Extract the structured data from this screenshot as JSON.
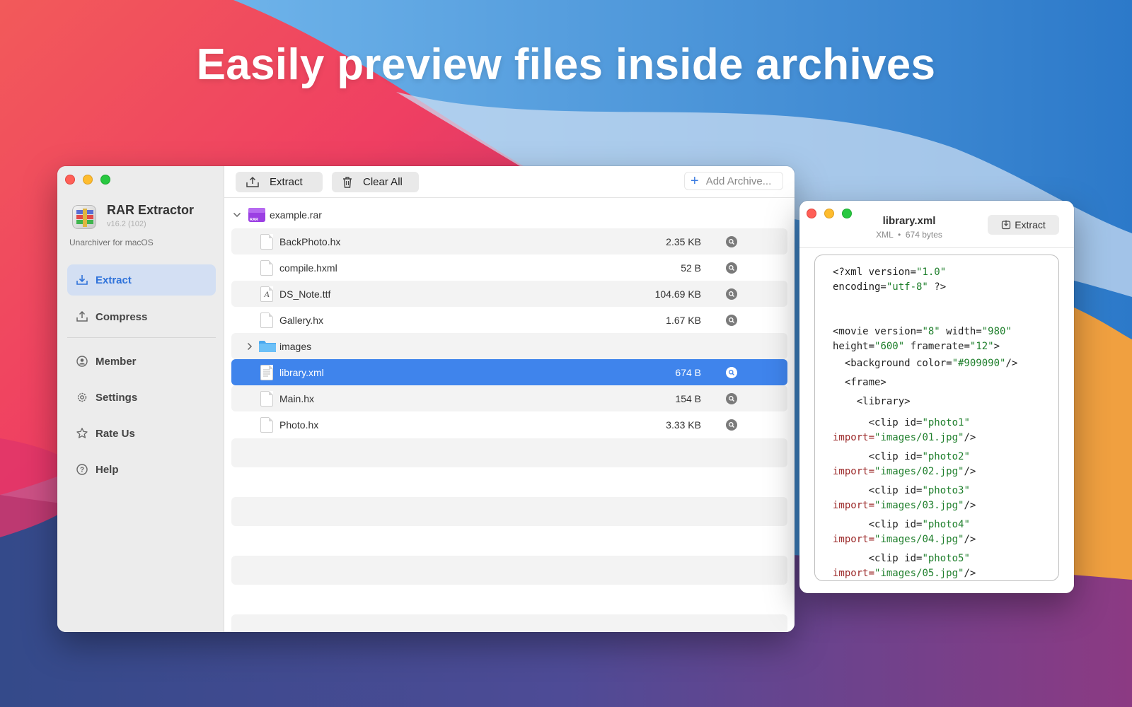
{
  "headline": "Easily preview files inside archives",
  "colors": {
    "accent": "#3f84ec",
    "sidebar_active_bg": "#d3dff3",
    "code_value": "#1f7f2c",
    "code_attr": "#9c2a2a"
  },
  "app": {
    "name": "RAR Extractor",
    "version": "v16.2 (102)",
    "subtitle": "Unarchiver for macOS",
    "nav": [
      {
        "label": "Extract",
        "icon": "extract-icon",
        "active": true
      },
      {
        "label": "Compress",
        "icon": "compress-icon"
      },
      {
        "label": "Member",
        "icon": "person-icon"
      },
      {
        "label": "Settings",
        "icon": "gear-icon"
      },
      {
        "label": "Rate Us",
        "icon": "star-icon"
      },
      {
        "label": "Help",
        "icon": "question-icon"
      }
    ]
  },
  "toolbar": {
    "extract_label": "Extract",
    "clear_label": "Clear All",
    "add_label": "Add Archive..."
  },
  "archive": {
    "name": "example.rar",
    "files": [
      {
        "name": "BackPhoto.hx",
        "size": "2.35 KB"
      },
      {
        "name": "compile.hxml",
        "size": "52 B"
      },
      {
        "name": "DS_Note.ttf",
        "size": "104.69 KB"
      },
      {
        "name": "Gallery.hx",
        "size": "1.67 KB"
      },
      {
        "name": "images",
        "size": ""
      },
      {
        "name": "library.xml",
        "size": "674 B",
        "selected": true
      },
      {
        "name": "Main.hx",
        "size": "154 B"
      },
      {
        "name": "Photo.hx",
        "size": "3.33 KB"
      }
    ]
  },
  "preview": {
    "title": "library.xml",
    "type": "XML",
    "separator": "•",
    "size": "674 bytes",
    "extract_label": "Extract",
    "code": {
      "l1a": "<?xml version=",
      "l1b": "\"1.0\"",
      "l2a": "encoding=",
      "l2b": "\"utf-8\"",
      "l2c": " ?>",
      "l3a": "<movie version=",
      "l3b": "\"8\"",
      "l3c": " width=",
      "l3d": "\"980\"",
      "l4a": "height=",
      "l4b": "\"600\"",
      "l4c": " framerate=",
      "l4d": "\"12\"",
      "l4e": ">",
      "l5a": "  <background color=",
      "l5b": "\"#909090\"",
      "l5c": "/>",
      "l6": "  <frame>",
      "l7": "    <library>",
      "clip_prefix": "      <clip id=",
      "import_attr": "import=",
      "close": "/>",
      "clips": [
        {
          "id": "\"photo1\"",
          "src": "\"images/01.jpg\""
        },
        {
          "id": "\"photo2\"",
          "src": "\"images/02.jpg\""
        },
        {
          "id": "\"photo3\"",
          "src": "\"images/03.jpg\""
        },
        {
          "id": "\"photo4\"",
          "src": "\"images/04.jpg\""
        },
        {
          "id": "\"photo5\"",
          "src": "\"images/05.jpg\""
        }
      ]
    }
  }
}
